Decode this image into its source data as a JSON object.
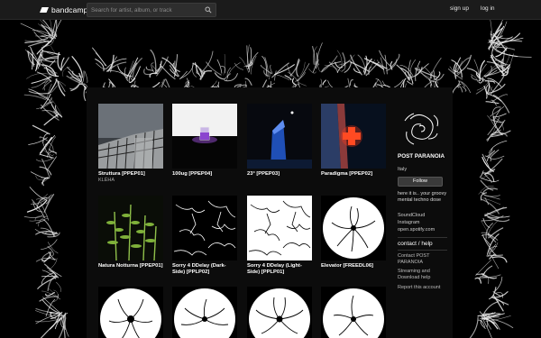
{
  "header": {
    "logo_text": "bandcamp",
    "search_placeholder": "Search for artist, album, or track",
    "signup": "sign up",
    "login": "log in"
  },
  "releases": [
    {
      "title": "Struttura [PPEP01]",
      "artist": "KLÉHA"
    },
    {
      "title": "100ug [PPEP04]",
      "artist": ""
    },
    {
      "title": "23° [PPEP03]",
      "artist": ""
    },
    {
      "title": "Paradigma [PPEP02]",
      "artist": ""
    },
    {
      "title": "Natura Notturna [PPEP01]",
      "artist": ""
    },
    {
      "title": "Sorry 4 DDelay (Dark-Side) [PPLP02]",
      "artist": ""
    },
    {
      "title": "Sorry 4 DDelay (Light-Side) [PPLP01]",
      "artist": ""
    },
    {
      "title": "Elevator [FREEDL06]",
      "artist": ""
    },
    {
      "title": "",
      "artist": ""
    },
    {
      "title": "",
      "artist": ""
    },
    {
      "title": "",
      "artist": ""
    },
    {
      "title": "",
      "artist": ""
    }
  ],
  "band": {
    "name": "POST PARANOIA",
    "location": "Italy",
    "follow": "Follow",
    "bio": "here it is.. your groovy mental techno dose",
    "links": [
      "SoundCloud",
      "Instagram",
      "open.spotify.com"
    ],
    "contact_heading": "contact / help",
    "contact_links": [
      "Contact POST PARANOIA",
      "Streaming and Download help",
      "Report this account"
    ]
  },
  "colors": {
    "topbar": "#1b1b1b",
    "background": "#000000",
    "panel": "#0c0c0c",
    "neon_cross": "#ff3a1a",
    "purple_glow": "#9a4dd8"
  }
}
